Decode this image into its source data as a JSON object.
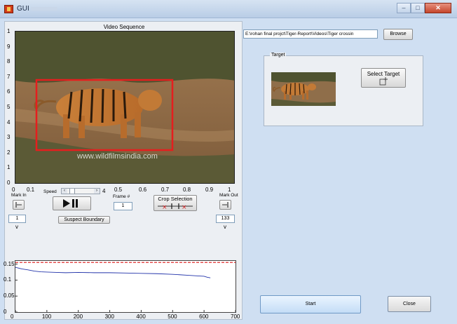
{
  "window": {
    "title": "GUI",
    "controls": {
      "minimize": "–",
      "maximize": "□",
      "close": "✕"
    }
  },
  "video": {
    "title": "Video Sequence",
    "y_ticks": [
      "1",
      "9",
      "8",
      "7",
      "6",
      "5",
      "4",
      "3",
      "2",
      "1",
      "0"
    ],
    "x_ticks": [
      "0",
      "0.1",
      "0.5",
      "0.6",
      "0.7",
      "0.8",
      "0.9",
      "1"
    ],
    "watermark": "www.wildfilmsindia.com"
  },
  "controls": {
    "mark_in_label": "Mark In",
    "mark_out_label": "Mark Out",
    "speed_label": "Speed",
    "speed_value_label": "4",
    "speed_level": 0.1,
    "frame_label": "Frame #",
    "frame_value": "1",
    "crop_label": "Crop Selection",
    "mark_in_value": "1",
    "mark_out_value": "133",
    "suspect_boundary_label": "Suspect Boundary"
  },
  "file": {
    "path": "E:\\rohan final projct\\Tiger-Report\\Videos\\Tiger crossin",
    "browse_label": "Browse"
  },
  "target": {
    "group_label": "Target",
    "select_label": "Select Target"
  },
  "buttons": {
    "start": "Start",
    "close": "Close"
  },
  "chart_data": {
    "type": "line",
    "title": "",
    "xlabel": "",
    "ylabel": "",
    "xlim": [
      0,
      700
    ],
    "ylim": [
      0,
      0.16
    ],
    "x_ticks": [
      0,
      100,
      200,
      300,
      400,
      500,
      600,
      700
    ],
    "y_ticks": [
      0,
      0.05,
      0.1,
      0.15
    ],
    "y_tick_labels": [
      "0",
      "0.05",
      "0.1",
      "0.15"
    ],
    "threshold": {
      "y": 0.155,
      "color": "#e03030",
      "style": "dashed"
    },
    "series": [
      {
        "color": "#2233aa",
        "x": [
          0,
          20,
          40,
          60,
          80,
          100,
          130,
          160,
          200,
          250,
          300,
          350,
          400,
          450,
          500,
          550,
          580,
          600,
          610,
          620
        ],
        "y": [
          0.14,
          0.135,
          0.132,
          0.128,
          0.126,
          0.125,
          0.124,
          0.123,
          0.124,
          0.123,
          0.123,
          0.122,
          0.121,
          0.12,
          0.118,
          0.115,
          0.113,
          0.112,
          0.109,
          0.107
        ]
      }
    ]
  }
}
